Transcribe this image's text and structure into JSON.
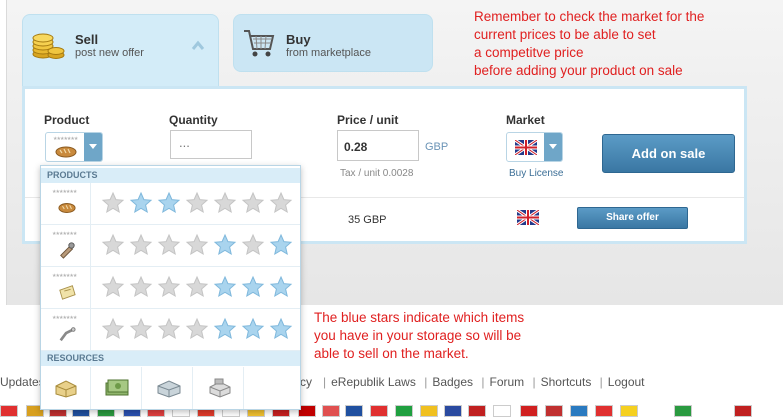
{
  "tabs": {
    "sell": {
      "title": "Sell",
      "subtitle": "post new offer"
    },
    "buy": {
      "title": "Buy",
      "subtitle": "from marketplace"
    }
  },
  "form": {
    "product_label": "Product",
    "quantity_label": "Quantity",
    "quantity_placeholder": "...",
    "price_label": "Price / unit",
    "price_value": "0.28",
    "currency": "GBP",
    "tax_text": "Tax / unit 0.0028",
    "market_label": "Market",
    "buy_license": "Buy License",
    "add_button": "Add on sale"
  },
  "offer": {
    "price": "35 GBP",
    "share_button": "Share offer"
  },
  "dropdown": {
    "products_header": "PRODUCTS",
    "resources_header": "RESOURCES",
    "products": [
      {
        "icon": "bread-icon",
        "stars_blue": [
          2,
          3
        ]
      },
      {
        "icon": "weapon-icon",
        "stars_blue": [
          5,
          7
        ]
      },
      {
        "icon": "ticket-icon",
        "stars_blue": [
          5,
          6,
          7
        ]
      },
      {
        "icon": "house-icon",
        "stars_blue": [
          5,
          6,
          7
        ]
      }
    ],
    "resources": [
      "grain-icon",
      "money-icon",
      "iron-icon",
      "materials-icon"
    ]
  },
  "annotations": {
    "top": [
      "Remember to check the market for the",
      "current prices to be able to set",
      "a competitve price",
      "before adding your product on sale"
    ],
    "middle": [
      "The blue stars indicate which items",
      "you have in your storage so will be",
      "able to sell on the market."
    ]
  },
  "footer": {
    "links": [
      "Updates",
      "cy",
      "eRepublik Laws",
      "Badges",
      "Forum",
      "Shortcuts",
      "Logout"
    ]
  },
  "colors": {
    "accent_blue": "#3a77a3",
    "tab_bg": "#d3ecf8",
    "annotation_red": "#e02020",
    "star_blue": "#a9d4ee",
    "star_grey": "#d8d8d8"
  }
}
